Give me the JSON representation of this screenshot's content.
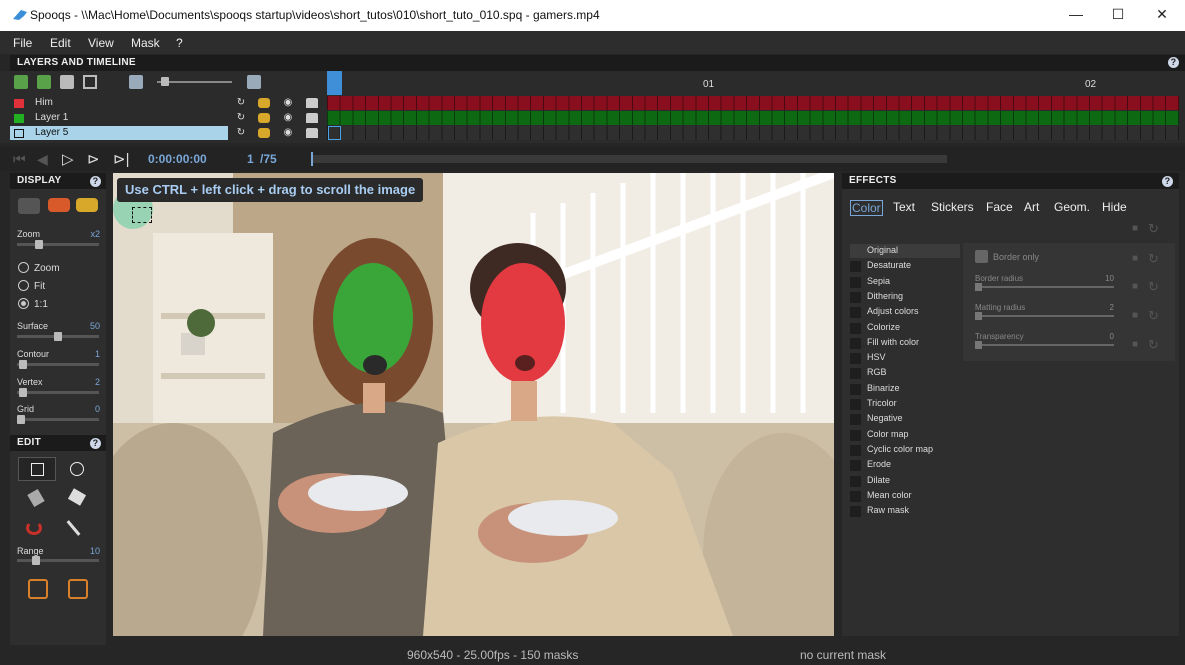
{
  "window": {
    "title": "Spooqs - \\\\Mac\\Home\\Documents\\spooqs startup\\videos\\short_tutos\\010\\short_tuto_010.spq - gamers.mp4",
    "minimize": "—",
    "maximize": "☐",
    "close": "✕"
  },
  "menu": [
    "File",
    "Edit",
    "View",
    "Mask",
    "?"
  ],
  "layers": {
    "header": "LAYERS AND TIMELINE",
    "help": "?",
    "rows": [
      {
        "name": "Him",
        "color": "#e0303a",
        "track": "#8a0f1e"
      },
      {
        "name": "Layer 1",
        "color": "#22b022",
        "track": "#0d6a12"
      },
      {
        "name": "Layer 5",
        "color": "",
        "track": "#2a2a2a"
      }
    ],
    "ruler": [
      "01",
      "02"
    ]
  },
  "transport": {
    "time": "0:00:00:00",
    "frame": "1",
    "total": "/75"
  },
  "display": {
    "header": "DISPLAY",
    "help": "?",
    "zoom_label": "Zoom",
    "zoom_value": "x2",
    "options": [
      "Zoom",
      "Fit",
      "1:1"
    ],
    "surface_label": "Surface",
    "surface_value": "50",
    "contour_label": "Contour",
    "contour_value": "1",
    "vertex_label": "Vertex",
    "vertex_value": "2",
    "grid_label": "Grid",
    "grid_value": "0"
  },
  "edit": {
    "header": "EDIT",
    "help": "?",
    "range_label": "Range",
    "range_value": "10"
  },
  "viewer": {
    "tooltip": "Use CTRL + left click + drag to scroll the image"
  },
  "effects": {
    "header": "EFFECTS",
    "help": "?",
    "tabs": [
      "Color",
      "Text",
      "Stickers",
      "Face",
      "Art",
      "Geom.",
      "Hide"
    ],
    "list": [
      "Original",
      "Desaturate",
      "Sepia",
      "Dithering",
      "Adjust colors",
      "Colorize",
      "Fill with color",
      "HSV",
      "RGB",
      "Binarize",
      "Tricolor",
      "Negative",
      "Color map",
      "Cyclic color map",
      "Erode",
      "Dilate",
      "Mean color",
      "Raw mask"
    ],
    "border_only": "Border only",
    "params": [
      {
        "label": "Border radius",
        "value": "10"
      },
      {
        "label": "Matting radius",
        "value": "2"
      },
      {
        "label": "Transparency",
        "value": "0"
      }
    ]
  },
  "status": {
    "info": "960x540  -  25.00fps  -  150 masks",
    "mask": "no current mask"
  },
  "colors": {
    "accent": "#7aa7d8",
    "him": "#e0303a",
    "layer1": "#22b022"
  }
}
